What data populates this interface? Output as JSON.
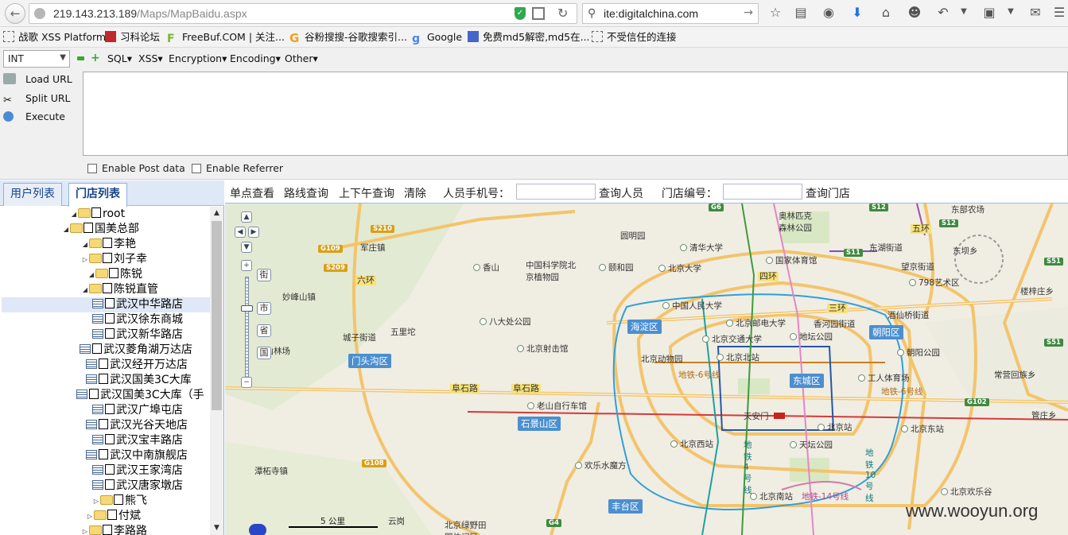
{
  "browser": {
    "url_host": "219.143.213.189",
    "url_path": "/Maps/MapBaidu.aspx",
    "search_text": "ite:digitalchina.com"
  },
  "bookmarks": [
    {
      "label": "战歌 XSS Platform",
      "icon": "page-icon"
    },
    {
      "label": "习科论坛",
      "icon": "slc-icon",
      "color": "#c0282b"
    },
    {
      "label": "FreeBuf.COM | 关注...",
      "icon": "freebuf-icon",
      "color": "#7bb62f"
    },
    {
      "label": "谷粉搜搜-谷歌搜索引...",
      "icon": "g-icon",
      "color": "#f2a116"
    },
    {
      "label": "Google",
      "icon": "google-icon",
      "color": "#4285f4"
    },
    {
      "label": "免费md5解密,md5在...",
      "icon": "md5-icon",
      "color": "#4466cc"
    },
    {
      "label": "不受信任的连接",
      "icon": "page-icon"
    }
  ],
  "hackbar": {
    "type_select": "INT",
    "menus": [
      "SQL▾",
      "XSS▾",
      "Encryption▾",
      "Encoding▾",
      "Other▾"
    ],
    "actions": [
      "Load URL",
      "Split URL",
      "Execute"
    ],
    "textarea_value": "",
    "checkbox_post": "Enable Post data",
    "checkbox_referrer": "Enable Referrer"
  },
  "left_panel": {
    "tabs": [
      "用户列表",
      "门店列表"
    ],
    "active_tab": "门店列表",
    "tree": [
      {
        "label": "root",
        "type": "folder",
        "toggle": "◢",
        "indent": 98
      },
      {
        "label": "国美总部",
        "type": "folder",
        "toggle": "◢",
        "indent": 88
      },
      {
        "label": "李艳",
        "type": "folder",
        "toggle": "◢",
        "indent": 112
      },
      {
        "label": "刘子幸",
        "type": "folder",
        "toggle": "▷",
        "indent": 112
      },
      {
        "label": "陈锐",
        "type": "folder",
        "toggle": "◢",
        "indent": 120
      },
      {
        "label": "陈锐直管",
        "type": "folder",
        "toggle": "◢",
        "indent": 112
      },
      {
        "label": "武汉中华路店",
        "type": "leaf",
        "indent": 116,
        "selected": true
      },
      {
        "label": "武汉徐东商城",
        "type": "leaf",
        "indent": 116
      },
      {
        "label": "武汉新华路店",
        "type": "leaf",
        "indent": 116
      },
      {
        "label": "武汉菱角湖万达店",
        "type": "leaf",
        "indent": 100
      },
      {
        "label": "武汉经开万达店",
        "type": "leaf",
        "indent": 108
      },
      {
        "label": "武汉国美3C大库",
        "type": "leaf",
        "indent": 108
      },
      {
        "label": "武汉国美3C大库（手",
        "type": "leaf",
        "indent": 96
      },
      {
        "label": "武汉广埠屯店",
        "type": "leaf",
        "indent": 116
      },
      {
        "label": "武汉光谷天地店",
        "type": "leaf",
        "indent": 108
      },
      {
        "label": "武汉宝丰路店",
        "type": "leaf",
        "indent": 116
      },
      {
        "label": "武汉中南旗舰店",
        "type": "leaf",
        "indent": 108
      },
      {
        "label": "武汉王家湾店",
        "type": "leaf",
        "indent": 116
      },
      {
        "label": "武汉唐家墩店",
        "type": "leaf",
        "indent": 116
      },
      {
        "label": "熊飞",
        "type": "folder",
        "toggle": "▷",
        "indent": 126
      },
      {
        "label": "付斌",
        "type": "folder",
        "toggle": "▷",
        "indent": 118
      },
      {
        "label": "李路路",
        "type": "folder",
        "toggle": "▷",
        "indent": 112
      }
    ]
  },
  "map_toolbar": {
    "single_view": "单点查看",
    "route_query": "路线查询",
    "ampm_query": "上下午查询",
    "clear": "清除",
    "phone_label": "人员手机号：",
    "phone_value": "",
    "query_person": "查询人员",
    "store_label": "门店编号：",
    "store_value": "",
    "query_store": "查询门店"
  },
  "map": {
    "zoom_labels": [
      "街",
      "市",
      "省",
      "国"
    ],
    "scale": "5 公里",
    "watermark": "www.wooyun.org",
    "districts": [
      "海淀区",
      "朝阳区",
      "门头沟区",
      "东城区",
      "石景山区",
      "丰台区"
    ],
    "places": [
      "奥林匹克森林公园",
      "圆明园",
      "清华大学",
      "东湖街道",
      "东坝乡",
      "东部农场",
      "军庄镇",
      "国家体育馆",
      "望京街道",
      "798艺术区",
      "香山",
      "中国科学院北京植物园",
      "颐和园",
      "北京大学",
      "妙峰山镇",
      "中国人民大学",
      "酒仙桥街道",
      "楼梓庄乡",
      "八大处公园",
      "北京邮电大学",
      "香河园街道",
      "五里坨",
      "城子街道",
      "北京射击馆",
      "北京交通大学",
      "地坛公园",
      "朝阳公园",
      "军山林场",
      "北京动物园",
      "北京北站",
      "工人体育场",
      "常营回族乡",
      "地铁-6号线",
      "地铁-6号线",
      "阜石路",
      "老山自行车馆",
      "天安门",
      "北京站",
      "北京东站",
      "管庄乡",
      "北京西站",
      "天坛公园",
      "潭柘寺镇",
      "欢乐水魔方",
      "北京南站",
      "地铁-14号线",
      "北京欢乐谷",
      "云岗",
      "北京绿野田园体闲区",
      "地铁4号线",
      "地铁10号线",
      "三环",
      "四环",
      "五环",
      "六环",
      "阜石路"
    ],
    "shields": [
      "G6",
      "S210",
      "G109",
      "S209",
      "S11",
      "S12",
      "S51",
      "S51",
      "G102",
      "G108",
      "G4",
      "S12"
    ]
  }
}
